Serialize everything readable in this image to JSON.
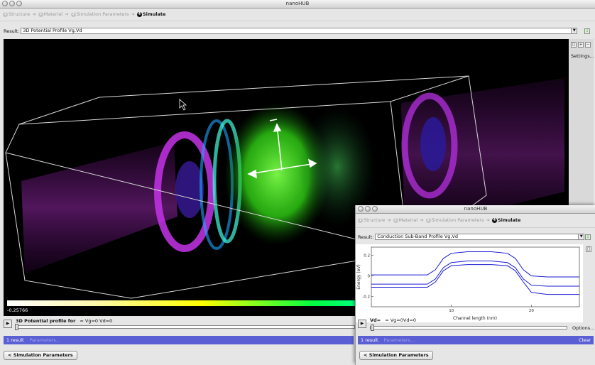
{
  "window": {
    "title": "nanoHUB"
  },
  "steps": [
    {
      "num": "1",
      "label": "Structure"
    },
    {
      "num": "2",
      "label": "Material"
    },
    {
      "num": "3",
      "label": "Simulation Parameters"
    },
    {
      "num": "4",
      "label": "Simulate"
    }
  ],
  "main": {
    "result_label": "Result:",
    "result_value": "3D Potential Profile Vg,Vd",
    "settings_label": "Settings...",
    "colorbar_min": "-0.25766",
    "profile_prefix": "3D Potential profile for",
    "profile_value": "= Vg=0 Vd=0",
    "status_count": "1 result",
    "status_params": "Parameters...",
    "sim_button": "< Simulation Parameters"
  },
  "popup": {
    "title": "nanoHUB",
    "result_label": "Result:",
    "result_value": "Conduction Sub-Band Profile Vg,Vd",
    "vd_label": "Vd=",
    "vd_value": "= Vg=0Vd=0",
    "options_label": "Options...",
    "status_count": "1 result",
    "status_params": "Parameters...",
    "clear_label": "Clear",
    "sim_button": "< Simulation Parameters"
  },
  "chart_data": {
    "type": "line",
    "xlabel": "Channel length (nm)",
    "ylabel": "Energy (eV)",
    "xlim": [
      0,
      26
    ],
    "ylim": [
      -0.3,
      0.28
    ],
    "xticks": [
      10,
      20
    ],
    "yticks": [
      0.2,
      0,
      -0.2
    ],
    "series": [
      {
        "x": [
          0,
          7,
          8,
          9,
          10,
          12,
          15,
          17,
          18,
          19,
          20,
          22,
          26
        ],
        "values": [
          0.01,
          0.01,
          0.06,
          0.17,
          0.22,
          0.235,
          0.235,
          0.22,
          0.17,
          0.06,
          0.0,
          -0.01,
          -0.01
        ]
      },
      {
        "x": [
          0,
          7,
          8,
          9,
          10,
          12,
          15,
          17,
          18,
          19,
          20,
          22,
          26
        ],
        "values": [
          -0.08,
          -0.08,
          -0.03,
          0.08,
          0.13,
          0.145,
          0.145,
          0.13,
          0.08,
          -0.03,
          -0.09,
          -0.1,
          -0.1
        ]
      },
      {
        "x": [
          0,
          7,
          8,
          9,
          10,
          12,
          15,
          17,
          18,
          19,
          20,
          22,
          26
        ],
        "values": [
          -0.11,
          -0.11,
          -0.06,
          0.05,
          0.1,
          0.11,
          0.11,
          0.1,
          0.05,
          -0.06,
          -0.16,
          -0.18,
          -0.18
        ]
      }
    ],
    "line_color": "#1a1ad6",
    "grid": false
  },
  "icons": {
    "window_buttons": "traffic-light-icons",
    "play": "play-icon",
    "download": "download-icon",
    "reset": "reset-view-icon",
    "zoom_in": "zoom-in-icon",
    "zoom_out": "zoom-out-icon"
  }
}
